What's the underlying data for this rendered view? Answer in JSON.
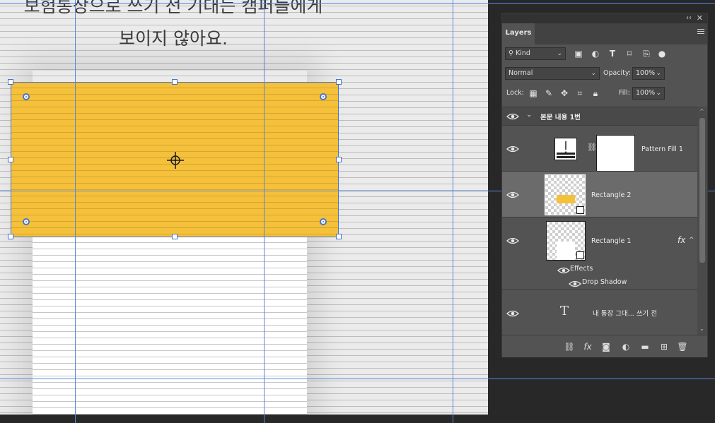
{
  "canvas": {
    "heading_lines": [
      "보험통장으로 쓰기 전 기대는 캠퍼들에게",
      "보이지 않아요."
    ]
  },
  "colors": {
    "accent_fill": "#f5c03a",
    "guide": "#5a86d8",
    "panel_bg": "#535353"
  },
  "panel": {
    "tab_label": "Layers",
    "filter": {
      "kind_label": "Kind",
      "icons": [
        "image-filter-icon",
        "adjustment-filter-icon",
        "type-filter-icon",
        "shape-filter-icon",
        "smart-object-filter-icon",
        "filter-toggle-icon"
      ]
    },
    "blend_mode": "Normal",
    "opacity_label": "Opacity:",
    "opacity_value": "100%",
    "lock_label": "Lock:",
    "fill_label": "Fill:",
    "fill_value": "100%"
  },
  "layers": {
    "group_name": "본문 내용 1번",
    "items": [
      {
        "name": "Pattern Fill 1",
        "type": "pattern-fill",
        "selected": false
      },
      {
        "name": "Rectangle 2",
        "type": "shape",
        "selected": true
      },
      {
        "name": "Rectangle 1",
        "type": "shape",
        "selected": false,
        "fx": "fx"
      },
      {
        "name": "내 통장 그대... 쓰기 전",
        "type": "text",
        "selected": false
      }
    ],
    "effects_label": "Effects",
    "drop_shadow_label": "Drop Shadow",
    "text_layer_glyph": "T"
  }
}
